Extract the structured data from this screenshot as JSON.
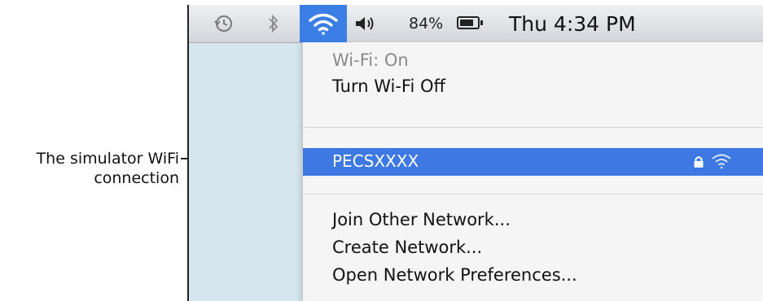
{
  "callout": {
    "line1": "The simulator WiFi",
    "line2": "connection"
  },
  "menubar": {
    "battery_percent": "84%",
    "clock": "Thu 4:34 PM",
    "icons": [
      "time-machine-icon",
      "bluetooth-icon",
      "wifi-icon",
      "volume-icon",
      "battery-icon"
    ],
    "wifi_highlight_color": "#3b7ee6"
  },
  "wifi_menu": {
    "status": "Wi-Fi: On",
    "toggle": "Turn Wi-Fi Off",
    "networks": [
      {
        "name": "PECSXXXX",
        "selected": true,
        "secured": true
      }
    ],
    "join_other": "Join Other Network...",
    "create": "Create Network...",
    "open_prefs": "Open Network Preferences..."
  }
}
